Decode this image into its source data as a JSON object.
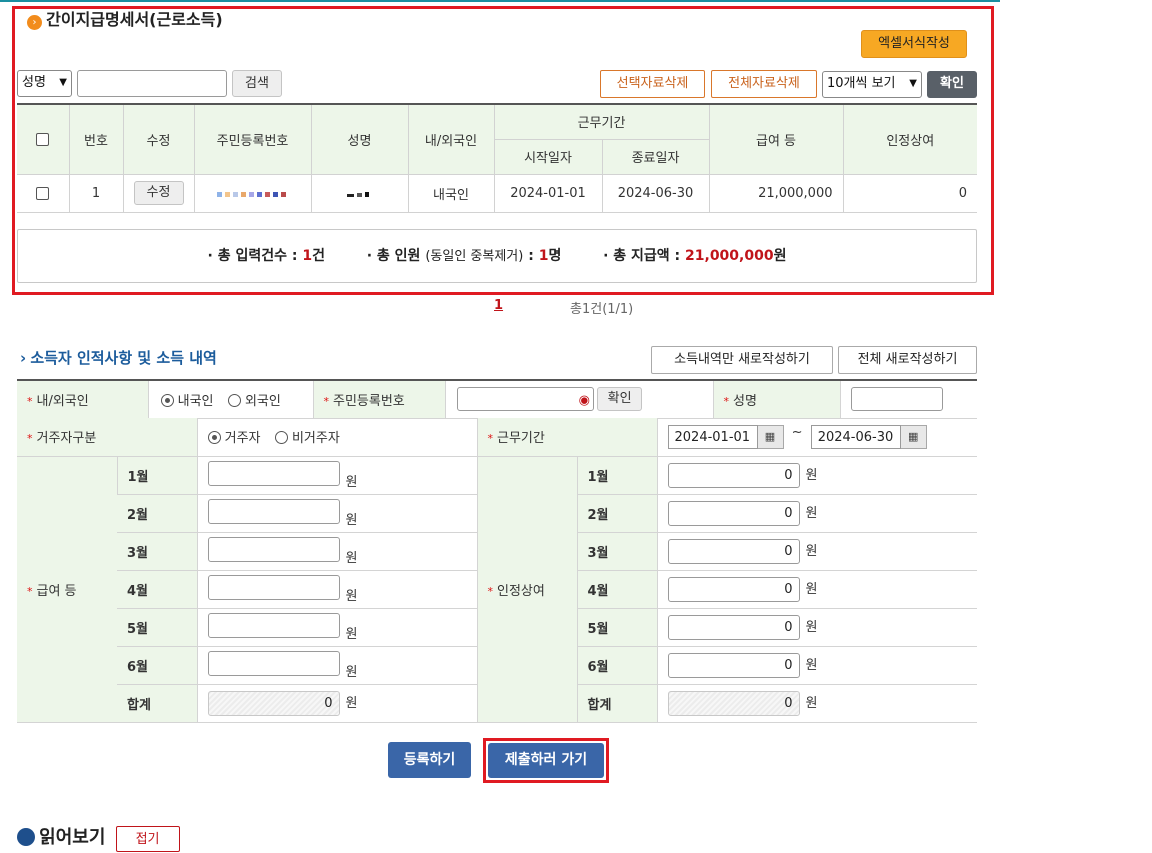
{
  "list_section": {
    "title": "간이지급명세서(근로소득)",
    "excel_button": "엑셀서식작성",
    "search_field_select": "성명",
    "search_input_value": "",
    "search_button": "검색",
    "delete_selected_button": "선택자료삭제",
    "delete_all_button": "전체자료삭제",
    "page_size_select": "10개씩 보기",
    "confirm_button": "확인",
    "columns": {
      "number": "번호",
      "edit": "수정",
      "resident_id": "주민등록번호",
      "name": "성명",
      "nationality": "내/외국인",
      "work_period": "근무기간",
      "start_date": "시작일자",
      "end_date": "종료일자",
      "salary": "급여 등",
      "recognized_bonus": "인정상여"
    },
    "rows": [
      {
        "number": "1",
        "edit_button": "수정",
        "nationality": "내국인",
        "start_date": "2024-01-01",
        "end_date": "2024-06-30",
        "salary": "21,000,000",
        "recognized_bonus": "0"
      }
    ],
    "summary": {
      "total_entries_label": "· 총 입력건수 : ",
      "total_entries_value": "1",
      "total_entries_unit": "건",
      "total_people_label": "· 총 인원 ",
      "total_people_note": "(동일인 중복제거)",
      "total_people_colon": " : ",
      "total_people_value": "1",
      "total_people_unit": "명",
      "total_paid_label": "· 총 지급액 : ",
      "total_paid_value": "21,000,000",
      "total_paid_unit": "원"
    }
  },
  "pager": {
    "current_page": "1",
    "total_text": "총1건(1/1)"
  },
  "form_section": {
    "title": "소득자 인적사항 및 소득 내역",
    "rewrite_income_button": "소득내역만 새로작성하기",
    "rewrite_all_button": "전체 새로작성하기",
    "nationality_label": "내/외국인",
    "nationality_options": [
      "내국인",
      "외국인"
    ],
    "nationality_selected": "내국인",
    "resident_id_label": "주민등록번호",
    "resident_id_value": "",
    "resident_id_confirm": "확인",
    "name_label": "성명",
    "name_value": "",
    "residency_label": "거주자구분",
    "residency_options": [
      "거주자",
      "비거주자"
    ],
    "residency_selected": "거주자",
    "work_period_label": "근무기간",
    "work_start": "2024-01-01",
    "work_period_sep": "~",
    "work_end": "2024-06-30",
    "salary_label": "급여 등",
    "bonus_label": "인정상여",
    "months": [
      "1월",
      "2월",
      "3월",
      "4월",
      "5월",
      "6월"
    ],
    "total_label": "합계",
    "currency_unit": "원",
    "salary_values": [
      "",
      "",
      "",
      "",
      "",
      ""
    ],
    "salary_total": "0",
    "bonus_values": [
      "0",
      "0",
      "0",
      "0",
      "0",
      "0"
    ],
    "bonus_total": "0",
    "register_button": "등록하기",
    "submit_button": "제출하러 가기"
  },
  "footer_section": {
    "title_partial": "읽어보기",
    "toggle_button": "접기"
  },
  "colors": {
    "accent_orange": "#f7a823",
    "highlight_red": "#e01a22",
    "header_green_bg": "#edf6e9",
    "primary_blue": "#3a66a8",
    "title_blue": "#1c5c9c",
    "value_red": "#c0141a"
  },
  "icons": {
    "title_bullet": "orange-circle-chevron-icon",
    "section_bullet": "chevron-right-icon",
    "calendar": "calendar-icon",
    "eye": "eye-icon",
    "dropdown": "chevron-down-icon"
  }
}
